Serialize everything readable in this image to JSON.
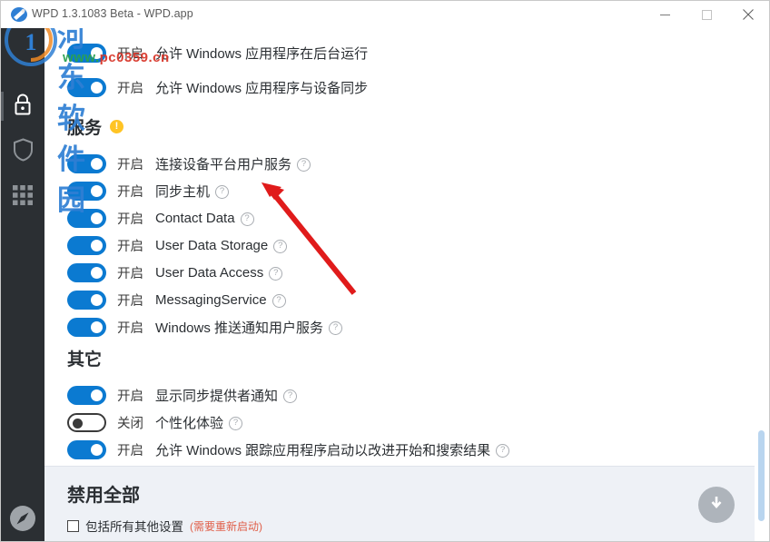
{
  "window": {
    "title": "WPD 1.3.1083 Beta - WPD.app",
    "app_icon": "wpd-logo-icon",
    "minimize_label": "—",
    "maximize_label": "□",
    "close_label": "✕"
  },
  "sidebar": {
    "items": [
      {
        "name": "privacy",
        "icon": "lock-icon",
        "selected": true
      },
      {
        "name": "firewall",
        "icon": "shield-icon",
        "selected": false
      },
      {
        "name": "apps",
        "icon": "grid-icon",
        "selected": false
      }
    ],
    "bottom_item": {
      "name": "about",
      "icon": "compass-icon"
    }
  },
  "main": {
    "top_rows": [
      {
        "state": "开启",
        "on": true,
        "label": "允许 Windows 应用程序在后台运行",
        "help": false
      },
      {
        "state": "开启",
        "on": true,
        "label": "允许 Windows 应用程序与设备同步",
        "help": false
      }
    ],
    "sections": [
      {
        "title": "服务",
        "warning": "!",
        "rows": [
          {
            "state": "开启",
            "on": true,
            "label": "连接设备平台用户服务",
            "help": true
          },
          {
            "state": "开启",
            "on": true,
            "label": "同步主机",
            "help": true
          },
          {
            "state": "开启",
            "on": true,
            "label": "Contact Data",
            "help": true
          },
          {
            "state": "开启",
            "on": true,
            "label": "User Data Storage",
            "help": true
          },
          {
            "state": "开启",
            "on": true,
            "label": "User Data Access",
            "help": true
          },
          {
            "state": "开启",
            "on": true,
            "label": "MessagingService",
            "help": true
          },
          {
            "state": "开启",
            "on": true,
            "label": "Windows 推送通知用户服务",
            "help": true
          }
        ]
      },
      {
        "title": "其它",
        "warning": "",
        "rows": [
          {
            "state": "开启",
            "on": true,
            "label": "显示同步提供者通知",
            "help": true
          },
          {
            "state": "关闭",
            "on": false,
            "label": "个性化体验",
            "help": true
          },
          {
            "state": "开启",
            "on": true,
            "label": "允许 Windows 跟踪应用程序启动以改进开始和搜索结果",
            "help": true
          }
        ]
      }
    ]
  },
  "footer": {
    "title": "禁用全部",
    "checkbox_label": "包括所有其他设置",
    "checkbox_checked": false,
    "restart_note": "(需要重新启动)",
    "download_icon": "download-arrow-icon"
  },
  "watermark": {
    "text": "河东软件园",
    "url_prefix": "www.",
    "url_mid": "pc0359",
    "url_suffix": ".cn"
  },
  "colors": {
    "accent": "#0b7ad1",
    "warning": "#ffc425",
    "sidebar": "#2b2f33",
    "footer_bg": "#eef1f6",
    "restart_note": "#e0604a",
    "scrollbar_thumb": "#b9d5ef"
  }
}
